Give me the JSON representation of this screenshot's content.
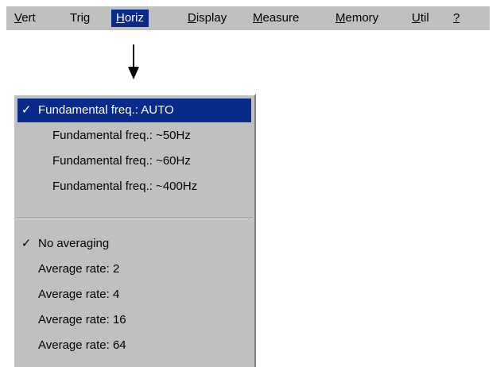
{
  "menubar": {
    "items": [
      {
        "u": "V",
        "rest": "ert"
      },
      {
        "u": "",
        "rest": "Trig"
      },
      {
        "u": "H",
        "rest": "oriz"
      },
      {
        "u": "D",
        "rest": "isplay"
      },
      {
        "u": "M",
        "rest": "easure"
      },
      {
        "u": "M",
        "rest": "emory"
      },
      {
        "u": "U",
        "rest": "til"
      },
      {
        "u": "?",
        "rest": ""
      }
    ]
  },
  "dropdown": {
    "fundamental": [
      {
        "label": "Fundamental freq.: AUTO",
        "check": "✓"
      },
      {
        "label": "Fundamental freq.: ~50Hz",
        "check": ""
      },
      {
        "label": "Fundamental freq.: ~60Hz",
        "check": ""
      },
      {
        "label": "Fundamental freq.: ~400Hz",
        "check": ""
      }
    ],
    "averaging": [
      {
        "label": "No averaging",
        "check": "✓"
      },
      {
        "label": "Average rate: 2",
        "check": ""
      },
      {
        "label": "Average rate: 4",
        "check": ""
      },
      {
        "label": "Average rate: 16",
        "check": ""
      },
      {
        "label": "Average rate: 64",
        "check": ""
      }
    ]
  },
  "colors": {
    "menu_bg": "#c0c0c0",
    "highlight": "#0a2a8a"
  }
}
